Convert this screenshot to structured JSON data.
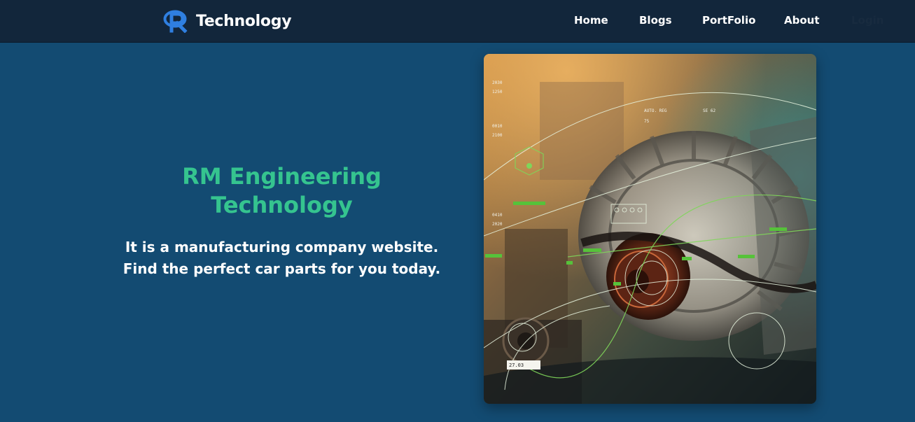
{
  "brand": {
    "name": "Technology",
    "logo_icon": "r-logo-icon"
  },
  "nav": {
    "links": [
      "Home",
      "Blogs",
      "PortFolio",
      "About"
    ],
    "extra": "Login"
  },
  "hero": {
    "title_line1": "RM Engineering",
    "title_line2": "Technology",
    "subtitle_line1": "It is a manufacturing company website.",
    "subtitle_line2": "Find the perfect car parts for you today."
  },
  "image": {
    "subject": "alternator-hud-image",
    "hud": {
      "readout_top": "AUTO. REG",
      "readout_right": "SE 62",
      "value_top": "75",
      "left_nums": [
        "2030",
        "1250",
        "0010",
        "2100",
        "0410",
        "2020"
      ],
      "bottom_value": "27.03"
    }
  },
  "colors": {
    "background": "#134b72",
    "navbar": "#12263b",
    "accent": "#35c48f",
    "logo_blue": "#2f7fe0"
  }
}
